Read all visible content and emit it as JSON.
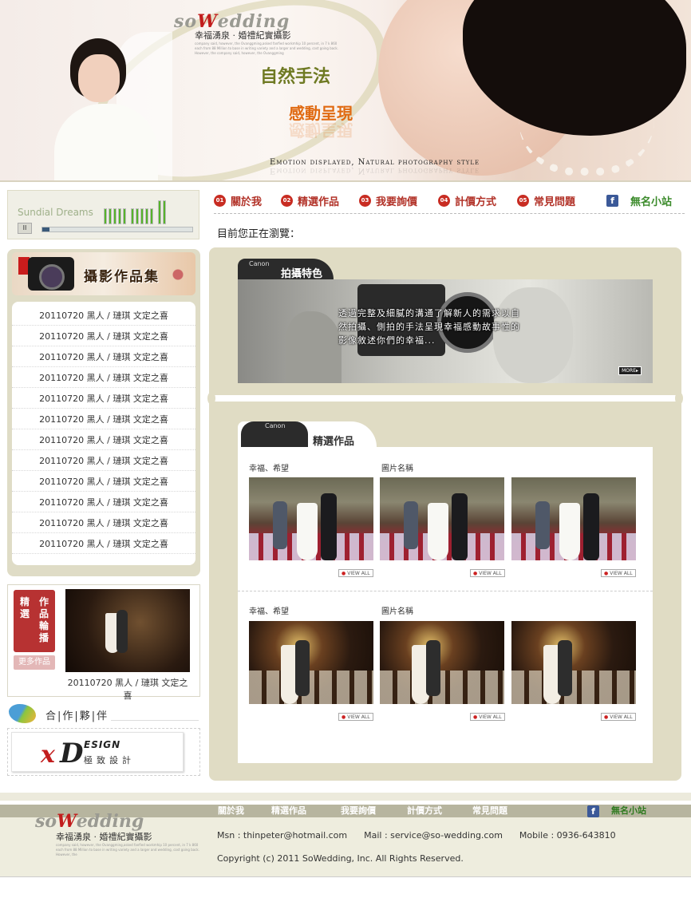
{
  "header": {
    "logo_left": "so",
    "logo_mark": "W",
    "logo_right": "edding",
    "logo_sub": "幸福湧泉 · 婚禮紀實攝影",
    "logo_tiny": "company said, however, the Ovanggming,asked fanfied workmhip 10 percent, in 7 k 860 each from 88 Million to base in writing variety and a larger and wedding, cost going back. However, the company said, however, the Ovanggming",
    "slogan1": "自然手法",
    "slogan2": "感動呈現",
    "tagline": "Emotion displayed, Natural photography style"
  },
  "player": {
    "title": "Sundial Dreams",
    "pause": "II",
    "progress": 0.05
  },
  "gallery": {
    "banner": "攝影作品集",
    "items": [
      "20110720 黑人 / 璉琪 文定之喜",
      "20110720 黑人 / 璉琪 文定之喜",
      "20110720 黑人 / 璉琪 文定之喜",
      "20110720 黑人 / 璉琪 文定之喜",
      "20110720 黑人 / 璉琪 文定之喜",
      "20110720 黑人 / 璉琪 文定之喜",
      "20110720 黑人 / 璉琪 文定之喜",
      "20110720 黑人 / 璉琪 文定之喜",
      "20110720 黑人 / 璉琪 文定之喜",
      "20110720 黑人 / 璉琪 文定之喜",
      "20110720 黑人 / 璉琪 文定之喜",
      "20110720 黑人 / 璉琪 文定之喜"
    ]
  },
  "featured": {
    "label_col1": "精選",
    "label_col2": "作品輪播",
    "more": "更多作品",
    "caption": "20110720 黑人 / 璉琪 文定之喜"
  },
  "partners": {
    "title": "合|作|夥|伴",
    "logo_x": "x",
    "logo_d": "D",
    "logo_esign": "ESIGN",
    "logo_sub": "極致設計"
  },
  "nav": {
    "items": [
      {
        "num": "01",
        "label": "關於我"
      },
      {
        "num": "02",
        "label": "精選作品"
      },
      {
        "num": "03",
        "label": "我要詢價"
      },
      {
        "num": "04",
        "label": "計價方式"
      },
      {
        "num": "05",
        "label": "常見問題"
      }
    ],
    "fb": "f",
    "blog": "無名小站"
  },
  "breadcrumb": "目前您正在瀏覽：",
  "features": {
    "brand": "Canon",
    "tab": "拍攝特色",
    "text": "透過完整及細膩的溝通了解新人的需求以自然拍攝、側拍的手法呈現幸福感動故事性的影像敘述你們的幸福...",
    "more": "MORE▸"
  },
  "works": {
    "brand": "Canon",
    "tab": "精選作品",
    "rows": [
      {
        "titles": [
          "幸福、希望",
          "圖片名稱"
        ],
        "view_all": "VIEW ALL"
      },
      {
        "titles": [
          "幸福、希望",
          "圖片名稱"
        ],
        "view_all": "VIEW ALL"
      }
    ]
  },
  "footer": {
    "nav": [
      "關於我",
      "精選作品",
      "我要詢價",
      "計價方式",
      "常見問題"
    ],
    "fb": "f",
    "blog": "無名小站",
    "logo_left": "so",
    "logo_mark": "W",
    "logo_right": "edding",
    "logo_sub": "幸福湧泉 · 婚禮紀實攝影",
    "logo_tiny": "company said, however, the Ovanggming,asked fanfied workmhip 10 percent, in 7 k 860 each from 88 Million to base in writing variety and a larger and wedding, cost going back. However, the",
    "contact": "Msn : thinpeter@hotmail.com      Mail : service@so-wedding.com      Mobile : 0936-643810",
    "copyright": "Copyright (c) 2011 SoWedding, Inc. All Rights Reserved."
  },
  "colors": {
    "accent_red": "#c82c22",
    "panel": "#e0dcc4",
    "blog_green": "#3a8a2a"
  }
}
